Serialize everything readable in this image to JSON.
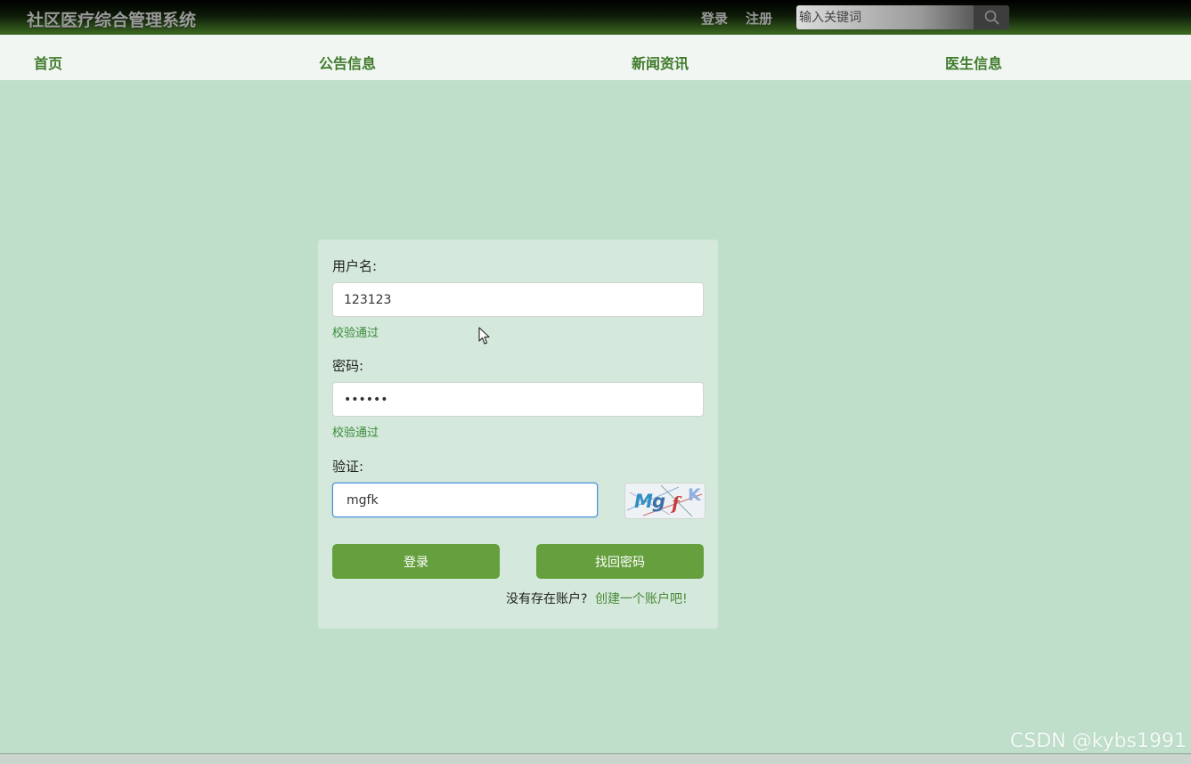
{
  "header": {
    "site_title": "社区医疗综合管理系统",
    "login_link": "登录",
    "register_link": "注册",
    "search_placeholder": "输入关键词"
  },
  "nav": {
    "items": [
      {
        "label": "首页"
      },
      {
        "label": "公告信息"
      },
      {
        "label": "新闻资讯"
      },
      {
        "label": "医生信息"
      }
    ]
  },
  "login_form": {
    "username_label": "用户名:",
    "username_value": "123123",
    "username_status": "校验通过",
    "password_label": "密码:",
    "password_value": "123123",
    "password_status": "校验通过",
    "captcha_label": "验证:",
    "captcha_value": "mgfk",
    "captcha_image_text": "MgfK",
    "login_button": "登录",
    "recover_button": "找回密码",
    "no_account_text": "没有存在账户?",
    "create_account_link": "创建一个账户吧!"
  },
  "watermark": "CSDN @kybs1991",
  "colors": {
    "accent_green": "#66a03e",
    "nav_text": "#3f7a2a",
    "page_background": "#bfdfcb",
    "status_ok": "#3a8a3a"
  }
}
